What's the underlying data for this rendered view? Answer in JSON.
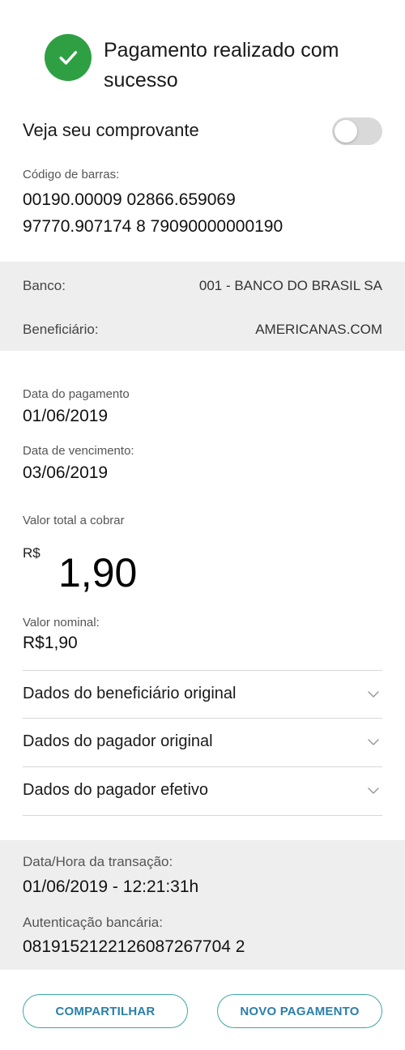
{
  "header": {
    "title": "Pagamento realizado com sucesso",
    "icon": "check-circle-icon",
    "icon_color": "#2ea043"
  },
  "receipt": {
    "label": "Veja seu comprovante",
    "toggle_on": false
  },
  "barcode": {
    "label": "Código de barras:",
    "line1": "00190.00009 02866.659069",
    "line2": "97770.907174 8 79090000000190"
  },
  "bank": {
    "bank_label": "Banco:",
    "bank_value": "001 - BANCO DO BRASIL SA",
    "beneficiary_label": "Beneficiário:",
    "beneficiary_value": "AMERICANAS.COM"
  },
  "payment": {
    "payment_date_label": "Data do pagamento",
    "payment_date": "01/06/2019",
    "due_date_label": "Data de vencimento:",
    "due_date": "03/06/2019",
    "total_label": "Valor total a cobrar",
    "currency": "R$",
    "total_amount": "1,90",
    "nominal_label": "Valor nominal:",
    "nominal_value": "R$1,90"
  },
  "sections": [
    {
      "label": "Dados do beneficiário original",
      "icon": "chevron-down-icon"
    },
    {
      "label": "Dados do pagador original",
      "icon": "chevron-down-icon"
    },
    {
      "label": "Dados do pagador efetivo",
      "icon": "chevron-down-icon"
    }
  ],
  "transaction": {
    "datetime_label": "Data/Hora da transação:",
    "datetime_value": "01/06/2019 - 12:21:31h",
    "auth_label": "Autenticação bancária:",
    "auth_value": "0819152122126087267704 2"
  },
  "actions": {
    "share_label": "COMPARTILHAR",
    "new_payment_label": "NOVO PAGAMENTO",
    "accent_color": "#3ea7a5"
  }
}
